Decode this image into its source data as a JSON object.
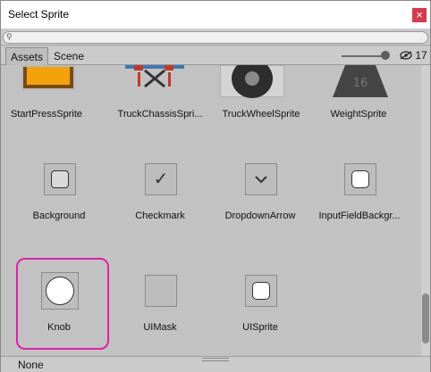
{
  "window": {
    "title": "Select Sprite",
    "close_glyph": "×"
  },
  "search": {
    "placeholder": "",
    "value": ""
  },
  "tabs": [
    {
      "label": "Assets",
      "active": true
    },
    {
      "label": "Scene",
      "active": false
    }
  ],
  "zoom": {
    "level_fraction": 0.92
  },
  "hidden_count": {
    "icon": "eye-hidden-icon",
    "value": "17"
  },
  "rows": [
    {
      "items": [
        {
          "name": "StartPressSprite"
        },
        {
          "name": "TruckChassisSpri..."
        },
        {
          "name": "TruckWheelSprite"
        },
        {
          "name": "WeightSprite"
        }
      ]
    },
    {
      "items": [
        {
          "name": "Background",
          "icon": "rounded-square-gray"
        },
        {
          "name": "Checkmark",
          "icon": "checkmark"
        },
        {
          "name": "DropdownArrow",
          "icon": "chevron-down"
        },
        {
          "name": "InputFieldBackgr...",
          "icon": "rounded-square-white"
        }
      ]
    },
    {
      "items": [
        {
          "name": "Knob",
          "icon": "circle-white",
          "selected": true
        },
        {
          "name": "UIMask",
          "icon": "empty"
        },
        {
          "name": "UISprite",
          "icon": "rounded-square-white"
        }
      ]
    }
  ],
  "status": {
    "selected_label": "None"
  },
  "colors": {
    "selection": "#e020a8",
    "close_button": "#d73a4a",
    "background": "#c2c2c2"
  }
}
